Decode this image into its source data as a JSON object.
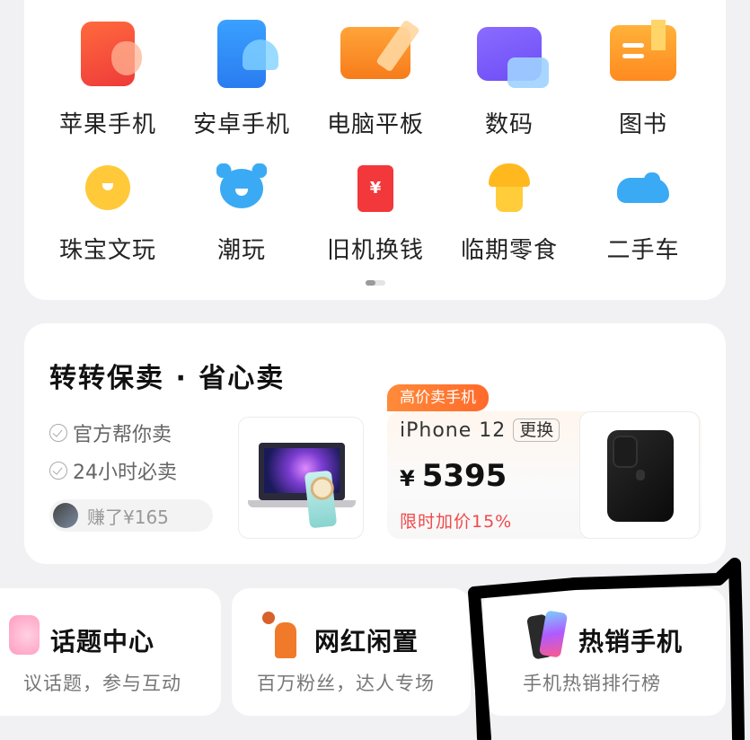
{
  "categories": [
    {
      "label": "苹果手机",
      "icon": "apple-phone-icon"
    },
    {
      "label": "安卓手机",
      "icon": "android-phone-icon"
    },
    {
      "label": "电脑平板",
      "icon": "laptop-tablet-icon"
    },
    {
      "label": "数码",
      "icon": "digital-camera-icon"
    },
    {
      "label": "图书",
      "icon": "book-icon"
    },
    {
      "label": "珠宝文玩",
      "icon": "jewelry-icon"
    },
    {
      "label": "潮玩",
      "icon": "bear-toy-icon"
    },
    {
      "label": "旧机换钱",
      "icon": "red-envelope-icon"
    },
    {
      "label": "临期零食",
      "icon": "snack-icon"
    },
    {
      "label": "二手车",
      "icon": "car-icon"
    }
  ],
  "red_envelope_symbol": "¥",
  "sell": {
    "title": "转转保卖 · 省心卖",
    "features": [
      "官方帮你卖",
      "24小时必卖"
    ],
    "earned": "赚了¥165",
    "offer_tag": "高价卖手机",
    "model": "iPhone 12",
    "swap_label": "更换",
    "currency": "¥",
    "price": "5395",
    "promo": "限时加价15%"
  },
  "tiles": [
    {
      "title": "话题中心",
      "subtitle": "议话题，参与互动",
      "icon": "topic-icon"
    },
    {
      "title": "网红闲置",
      "subtitle": "百万粉丝，达人专场",
      "icon": "influencer-icon"
    },
    {
      "title": "热销手机",
      "subtitle": "手机热销排行榜",
      "icon": "hot-phone-icon"
    }
  ],
  "colors": {
    "accent_orange": "#ff7a2a",
    "promo_red": "#f0494b",
    "background": "#f1f1f3"
  }
}
